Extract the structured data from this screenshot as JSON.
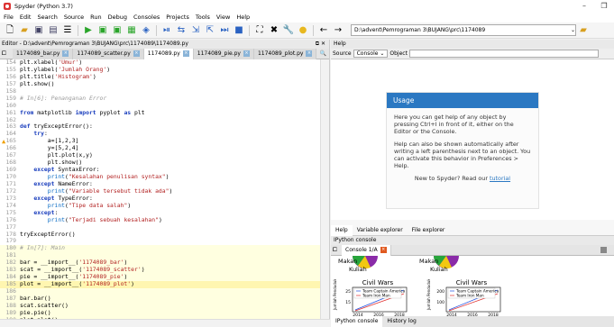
{
  "window": {
    "title": "Spyder (Python 3.7)",
    "minimize": "–",
    "maximize": "❐"
  },
  "menu": [
    "File",
    "Edit",
    "Search",
    "Source",
    "Run",
    "Debug",
    "Consoles",
    "Projects",
    "Tools",
    "View",
    "Help"
  ],
  "toolbar": {
    "path": "D:\\advent\\Pemrograman 3\\BUJANG\\prc\\1174089"
  },
  "editor": {
    "pane_title": "Editor - D:\\advent\\Pemrograman 3\\BUJANG\\prc\\1174089\\1174089.py",
    "tabs": [
      "1174089_bar.py",
      "1174089_scatter.py",
      "1174089.py",
      "1174089_pie.py",
      "1174089_plot.py"
    ],
    "active_tab": 2,
    "lines": [
      {
        "n": "154",
        "t": "plt.xlabel('Umur')"
      },
      {
        "n": "155",
        "t": "plt.ylabel('Jumlah Orang')"
      },
      {
        "n": "156",
        "t": "plt.title('Histogram')"
      },
      {
        "n": "157",
        "t": "plt.show()"
      },
      {
        "n": "158",
        "t": ""
      },
      {
        "n": "159",
        "t": "# In[6]: Penanganan Error"
      },
      {
        "n": "160",
        "t": ""
      },
      {
        "n": "161",
        "t": "from matplotlib import pyplot as plt"
      },
      {
        "n": "162",
        "t": ""
      },
      {
        "n": "163",
        "t": "def tryExceptError():"
      },
      {
        "n": "164",
        "t": "    try:"
      },
      {
        "n": "165",
        "t": "        a=[1,2,3]"
      },
      {
        "n": "166",
        "t": "        y=[5,2,4]"
      },
      {
        "n": "167",
        "t": "        plt.plot(x,y)"
      },
      {
        "n": "168",
        "t": "        plt.show()"
      },
      {
        "n": "169",
        "t": "    except SyntaxError:"
      },
      {
        "n": "170",
        "t": "        print(\"Kesalahan penulisan syntax\")"
      },
      {
        "n": "171",
        "t": "    except NameError:"
      },
      {
        "n": "172",
        "t": "        print(\"Variable tersebut tidak ada\")"
      },
      {
        "n": "173",
        "t": "    except TypeError:"
      },
      {
        "n": "174",
        "t": "        print(\"Tipe data salah\")"
      },
      {
        "n": "175",
        "t": "    except:"
      },
      {
        "n": "176",
        "t": "        print(\"Terjadi sebuah kesalahan\")"
      },
      {
        "n": "177",
        "t": ""
      },
      {
        "n": "178",
        "t": "tryExceptError()"
      },
      {
        "n": "179",
        "t": ""
      },
      {
        "n": "180",
        "t": "# In[7]: Main"
      },
      {
        "n": "181",
        "t": ""
      },
      {
        "n": "182",
        "t": "bar = __import__('1174089_bar')"
      },
      {
        "n": "183",
        "t": "scat = __import__('1174089_scatter')"
      },
      {
        "n": "184",
        "t": "pie = __import__('1174089_pie')"
      },
      {
        "n": "185",
        "t": "plot = __import__('1174089_plot')"
      },
      {
        "n": "186",
        "t": ""
      },
      {
        "n": "187",
        "t": "bar.bar()"
      },
      {
        "n": "188",
        "t": "scat.scatter()"
      },
      {
        "n": "189",
        "t": "pie.pie()"
      },
      {
        "n": "190",
        "t": "plot.plot()"
      }
    ]
  },
  "help": {
    "pane_title": "Help",
    "source_label": "Source",
    "source_value": "Console",
    "object_label": "Object",
    "usage_title": "Usage",
    "p1": "Here you can get help of any object by pressing Ctrl+I in front of it, either on the Editor or the Console.",
    "p2": "Help can also be shown automatically after writing a left parenthesis next to an object. You can activate this behavior in Preferences > Help.",
    "p3a": "New to Spyder? Read our ",
    "p3b": "tutorial"
  },
  "right_tabs": [
    "Help",
    "Variable explorer",
    "File explorer"
  ],
  "console": {
    "pane_title": "IPython console",
    "tab": "Console 1/A",
    "pie_labels": [
      "Makan",
      "Kuliah"
    ],
    "plots": [
      {
        "title": "Civil Wars",
        "ylabel": "Jumlah Penduduk",
        "xlabel": "Tahun",
        "yticks": [
          "25",
          "15"
        ],
        "xticks": [
          "2014",
          "2016",
          "2018"
        ],
        "legend": [
          "Team Captain America",
          "Team Iron Man"
        ]
      },
      {
        "title": "Civil Wars",
        "ylabel": "Jumlah Penduduk",
        "xlabel": "Tahun",
        "yticks": [
          "200",
          "100"
        ],
        "xticks": [
          "2014",
          "2016",
          "2018"
        ],
        "legend": [
          "Team Captain America",
          "Team Iron Man"
        ]
      }
    ],
    "bottom_tabs": [
      "IPython console",
      "History log"
    ]
  },
  "colors": {
    "accent": "#2b78c2",
    "run": "#2aa52a",
    "keyword": "#1a3ebd",
    "string": "#b22222"
  }
}
